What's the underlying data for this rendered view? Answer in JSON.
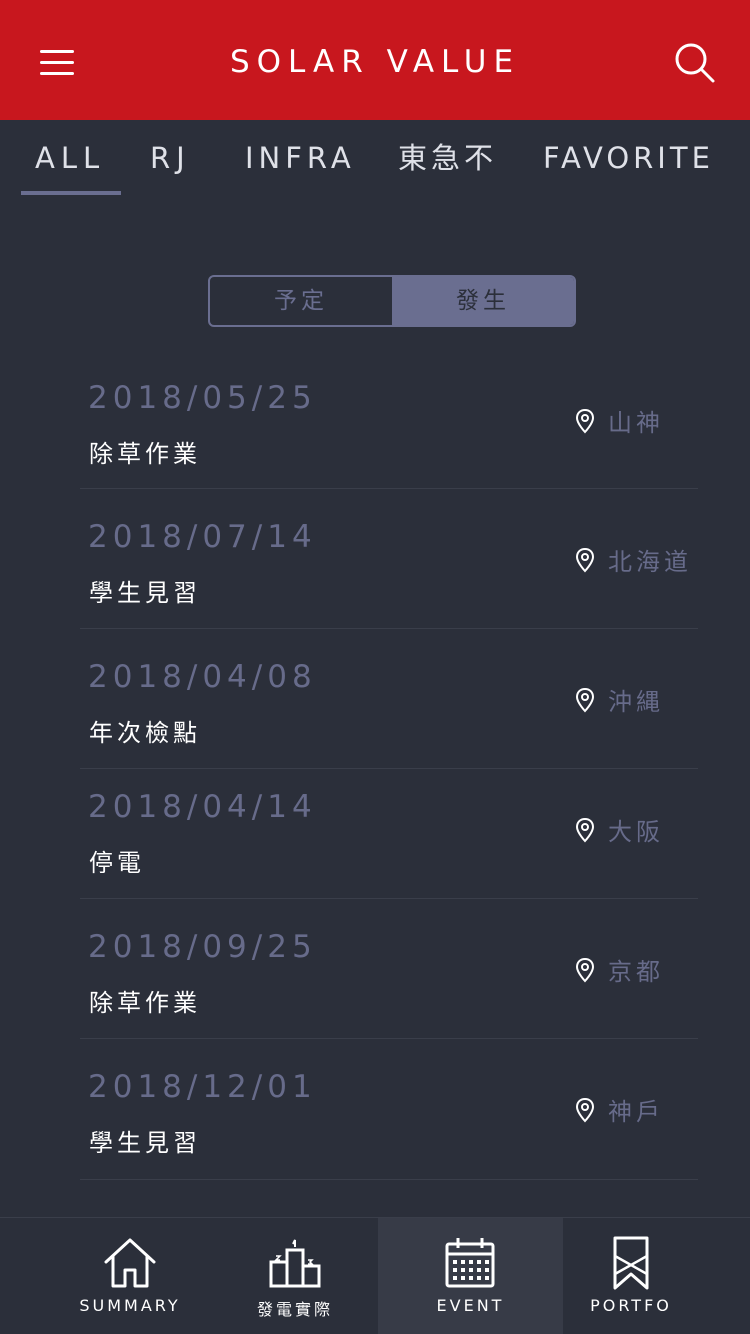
{
  "header": {
    "title": "SOLAR VALUE",
    "menu_icon": "menu-icon",
    "search_icon": "search-icon",
    "bg_color": "#c8171e"
  },
  "tabs": [
    {
      "label": "ALL",
      "active": true
    },
    {
      "label": "RJ",
      "active": false
    },
    {
      "label": "INFRA",
      "active": false
    },
    {
      "label": "東急不",
      "active": false
    },
    {
      "label": "FAVORITE",
      "active": false
    }
  ],
  "segment": {
    "options": [
      {
        "label": "予定",
        "active": false
      },
      {
        "label": "發生",
        "active": true
      }
    ]
  },
  "events": [
    {
      "date": "2018/05/25",
      "name": "除草作業",
      "location": "山神"
    },
    {
      "date": "2018/07/14",
      "name": "學生見習",
      "location": "北海道"
    },
    {
      "date": "2018/04/08",
      "name": "年次檢點",
      "location": "沖縄"
    },
    {
      "date": "2018/04/14",
      "name": "停電",
      "location": "大阪"
    },
    {
      "date": "2018/09/25",
      "name": "除草作業",
      "location": "京都"
    },
    {
      "date": "2018/12/01",
      "name": "學生見習",
      "location": "神戶"
    }
  ],
  "bottom_nav": [
    {
      "label": "SUMMARY",
      "icon": "home-icon",
      "active": false
    },
    {
      "label": "發電實際",
      "icon": "podium-icon",
      "active": false
    },
    {
      "label": "EVENT",
      "icon": "calendar-icon",
      "active": true
    },
    {
      "label": "PORTFO",
      "icon": "bookmark-icon",
      "active": false
    }
  ],
  "colors": {
    "background": "#2b2f3a",
    "accent": "#6a6e90",
    "brand_red": "#c8171e"
  }
}
